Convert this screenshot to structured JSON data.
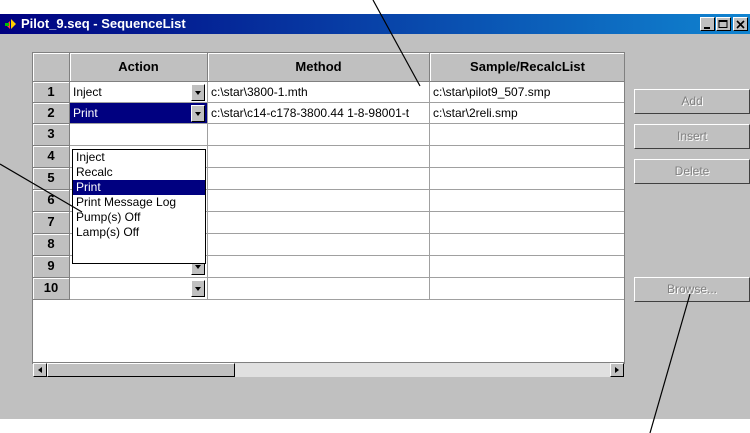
{
  "window": {
    "title": "Pilot_9.seq - SequenceList"
  },
  "grid": {
    "columns": [
      "Action",
      "Method",
      "Sample/RecalcList"
    ],
    "rows": [
      {
        "num": "1",
        "action": "Inject",
        "method": "c:\\star\\3800-1.mth",
        "sample": "c:\\star\\pilot9_507.smp"
      },
      {
        "num": "2",
        "action": "Print",
        "method": "c:\\star\\c14-c178-3800.44 1-8-98001-t",
        "sample": "c:\\star\\2reli.smp"
      },
      {
        "num": "3",
        "action": "",
        "method": "",
        "sample": ""
      },
      {
        "num": "4",
        "action": "",
        "method": "",
        "sample": ""
      },
      {
        "num": "5",
        "action": "",
        "method": "",
        "sample": ""
      },
      {
        "num": "6",
        "action": "",
        "method": "",
        "sample": ""
      },
      {
        "num": "7",
        "action": "",
        "method": "",
        "sample": ""
      },
      {
        "num": "8",
        "action": "",
        "method": "",
        "sample": ""
      },
      {
        "num": "9",
        "action": "",
        "method": "",
        "sample": ""
      },
      {
        "num": "10",
        "action": "",
        "method": "",
        "sample": ""
      }
    ]
  },
  "dropdown": {
    "options": [
      "Inject",
      "Recalc",
      "Print",
      "Print Message Log",
      "Pump(s) Off",
      "Lamp(s) Off"
    ],
    "selected": "Print"
  },
  "buttons": {
    "add": "Add",
    "insert": "Insert",
    "delete": "Delete",
    "browse": "Browse..."
  },
  "colors": {
    "title_bar": "#000080",
    "selection": "#000080",
    "window_bg": "#c0c0c0"
  }
}
